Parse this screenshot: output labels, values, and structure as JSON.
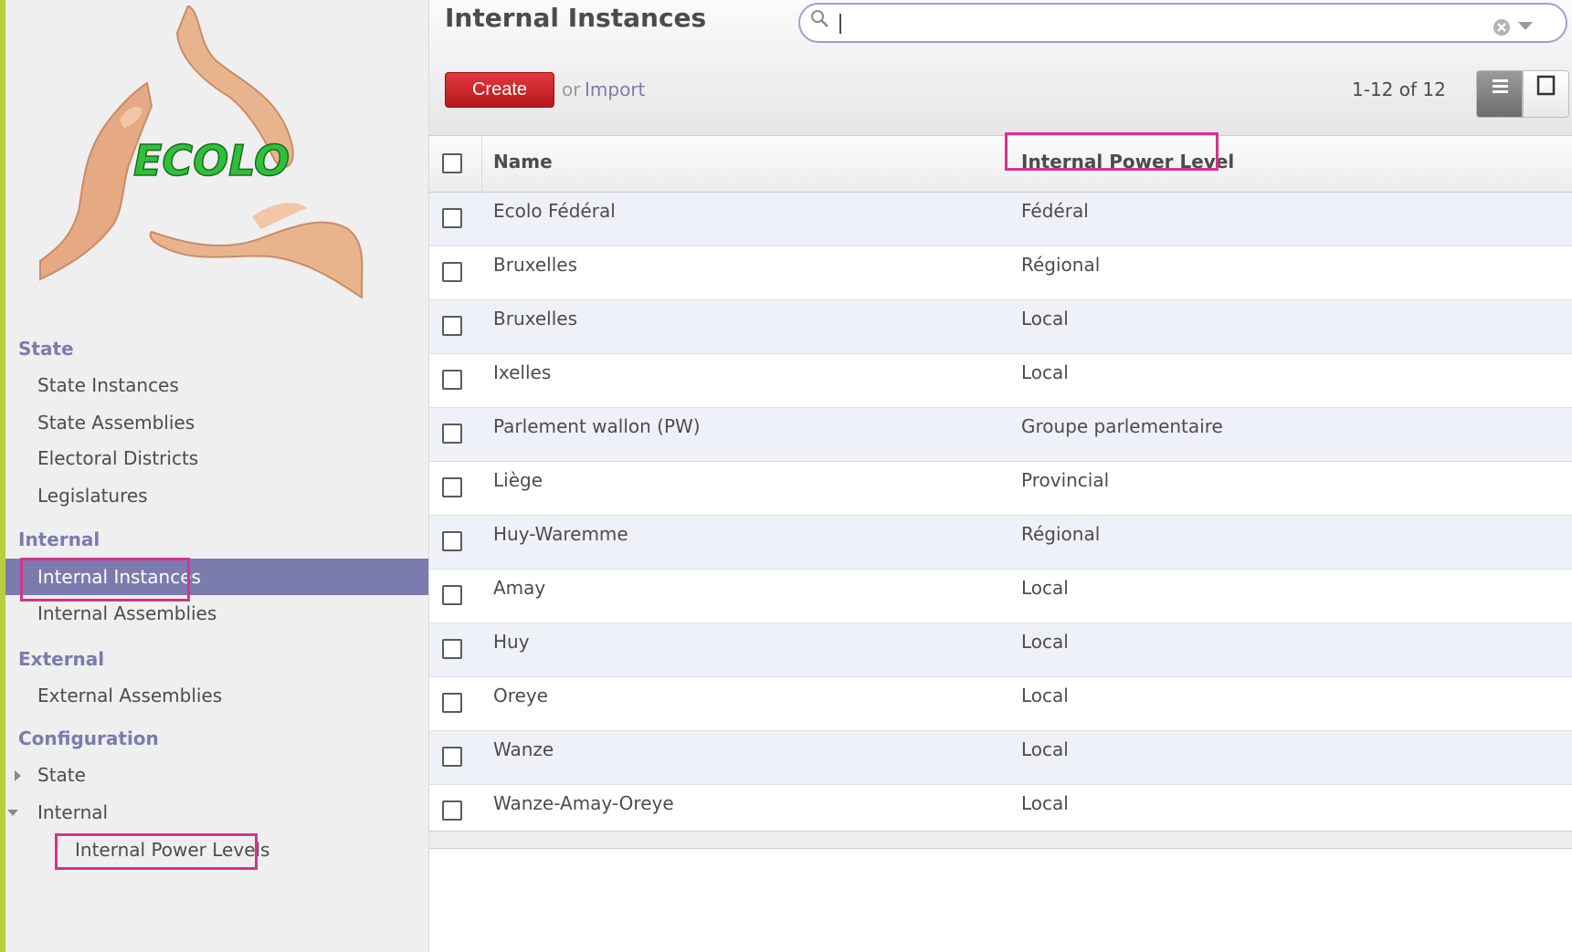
{
  "sidebar": {
    "logo_text": "ECOLO",
    "sections": {
      "state": "State",
      "internal": "Internal",
      "external": "External",
      "configuration": "Configuration"
    },
    "items": {
      "state_instances": "State Instances",
      "state_assemblies": "State Assemblies",
      "electoral_districts": "Electoral Districts",
      "legislatures": "Legislatures",
      "internal_instances": "Internal Instances",
      "internal_assemblies": "Internal Assemblies",
      "external_assemblies": "External Assemblies",
      "config_state": "State",
      "config_internal": "Internal",
      "internal_power_levels": "Internal Power Levels"
    },
    "active_item": "Internal Instances"
  },
  "header": {
    "title": "Internal Instances",
    "search_value": "",
    "create_label": "Create",
    "or_label": "or",
    "import_label": "Import",
    "pager": "1-12 of 12"
  },
  "table": {
    "columns": [
      "Name",
      "Internal Power Level"
    ],
    "rows": [
      {
        "name": "Ecolo Fédéral",
        "level": "Fédéral"
      },
      {
        "name": "Bruxelles",
        "level": "Régional"
      },
      {
        "name": "Bruxelles",
        "level": "Local"
      },
      {
        "name": "Ixelles",
        "level": "Local"
      },
      {
        "name": "Parlement wallon (PW)",
        "level": "Groupe parlementaire"
      },
      {
        "name": "Liège",
        "level": "Provincial"
      },
      {
        "name": "Huy-Waremme",
        "level": "Régional"
      },
      {
        "name": "Amay",
        "level": "Local"
      },
      {
        "name": "Huy",
        "level": "Local"
      },
      {
        "name": "Oreye",
        "level": "Local"
      },
      {
        "name": "Wanze",
        "level": "Local"
      },
      {
        "name": "Wanze-Amay-Oreye",
        "level": "Local"
      }
    ]
  },
  "colors": {
    "accent": "#7c7bad",
    "create_button": "#c8262c",
    "highlight_box": "#d6338b",
    "row_alt": "#eef1f8"
  }
}
